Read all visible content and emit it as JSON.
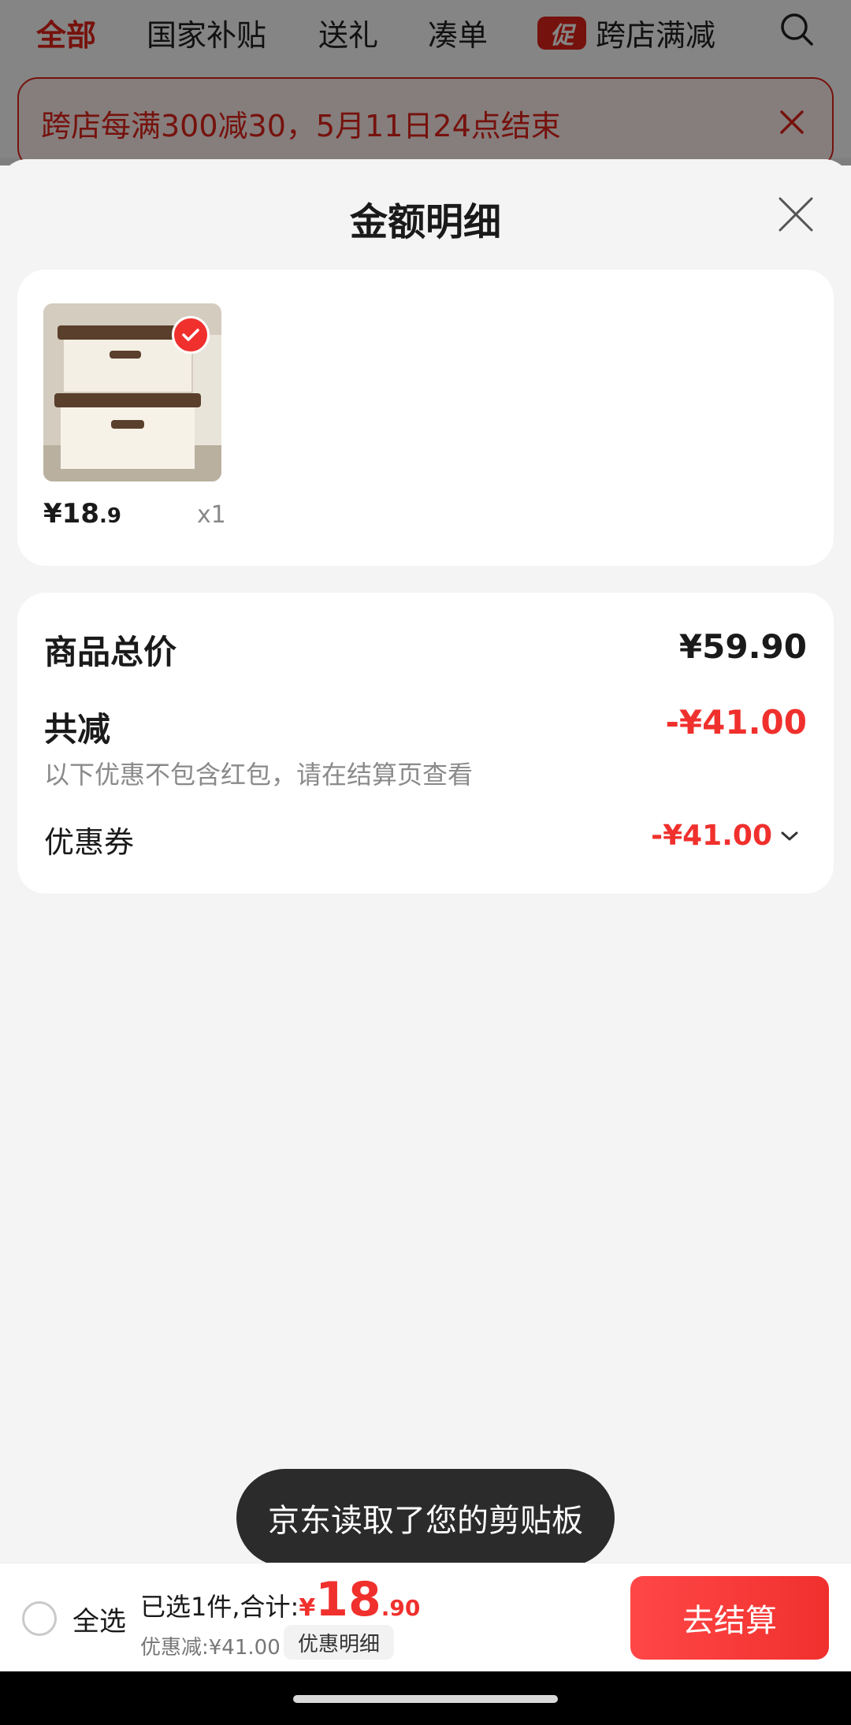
{
  "top_nav": {
    "tabs": [
      {
        "label": "全部",
        "active": true
      },
      {
        "label": "国家补贴"
      },
      {
        "label": "送礼"
      },
      {
        "label": "凑单"
      },
      {
        "label": "跨店满减",
        "badge": "促"
      }
    ],
    "search_icon": "search-icon"
  },
  "banner": {
    "text": "跨店每满300减30，5月11日24点结束",
    "close_icon": "close-icon"
  },
  "sheet": {
    "title": "金额明细",
    "close_icon": "close-icon",
    "item": {
      "price_int": "¥18",
      "price_dec": ".9",
      "qty": "x1",
      "checked": true,
      "image_icon": "storage-box-thumbnail"
    },
    "summary": {
      "total_label": "商品总价",
      "total_value": "¥59.90",
      "discount_label": "共减",
      "discount_value": "-¥41.00",
      "note": "以下优惠不包含红包，请在结算页查看",
      "coupon_label": "优惠券",
      "coupon_value": "-¥41.00",
      "coupon_icon": "chevron-down-icon"
    }
  },
  "toast": {
    "text": "京东读取了您的剪贴板"
  },
  "bottom_bar": {
    "select_all": "全选",
    "selected_text": "已选1件,合计:",
    "currency": "¥",
    "total_int": "18",
    "total_dec": ".90",
    "saved": "优惠减:¥41.00",
    "detail_button": "优惠明细",
    "checkout_button": "去结算"
  },
  "colors": {
    "accent": "#e2231a",
    "price_red": "#f0302d",
    "checkout_button": "#f0302d"
  }
}
